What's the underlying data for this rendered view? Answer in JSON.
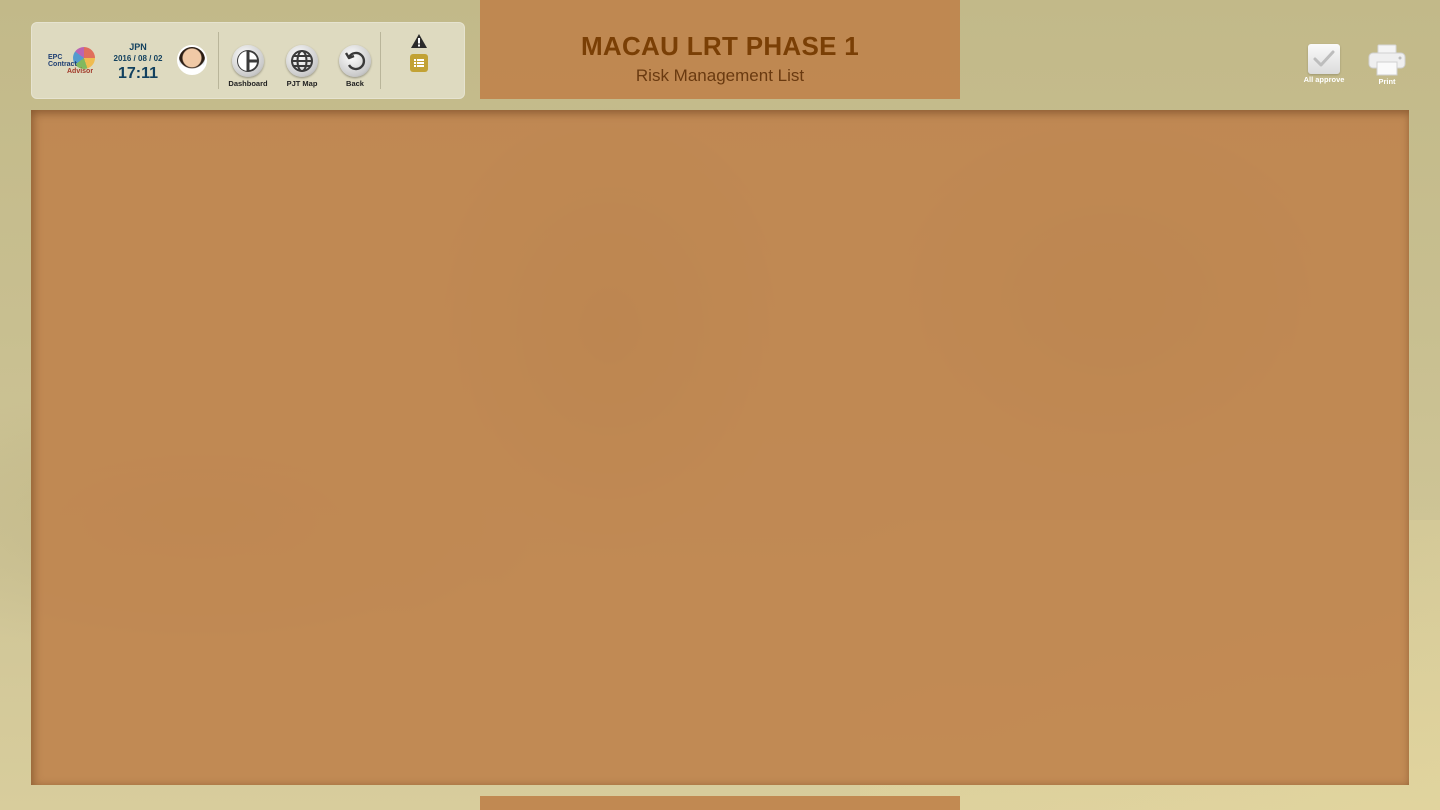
{
  "header": {
    "clock": {
      "timezone": "JPN",
      "date": "2016 / 08 / 02",
      "time": "17:11"
    },
    "logo": {
      "line1": "EPC",
      "line2": "Contract",
      "line3": "Advisor"
    },
    "nav": [
      {
        "label": "Dashboard",
        "icon": "dashboard-icon"
      },
      {
        "label": "PJT Map",
        "icon": "globe-icon"
      },
      {
        "label": "Back",
        "icon": "back-arrow-icon"
      }
    ],
    "status_icons": [
      "alert-icon",
      "list-icon"
    ]
  },
  "title_panel": {
    "title": "MACAU LRT PHASE 1",
    "subtitle": "Risk Management List"
  },
  "actions": {
    "all_approve": "All approve",
    "print": "Print"
  },
  "colors": {
    "panel": "#bf834c",
    "title_text": "#7a3f05",
    "control_bar": "#dedac0",
    "list_icon": "#c2a235"
  }
}
